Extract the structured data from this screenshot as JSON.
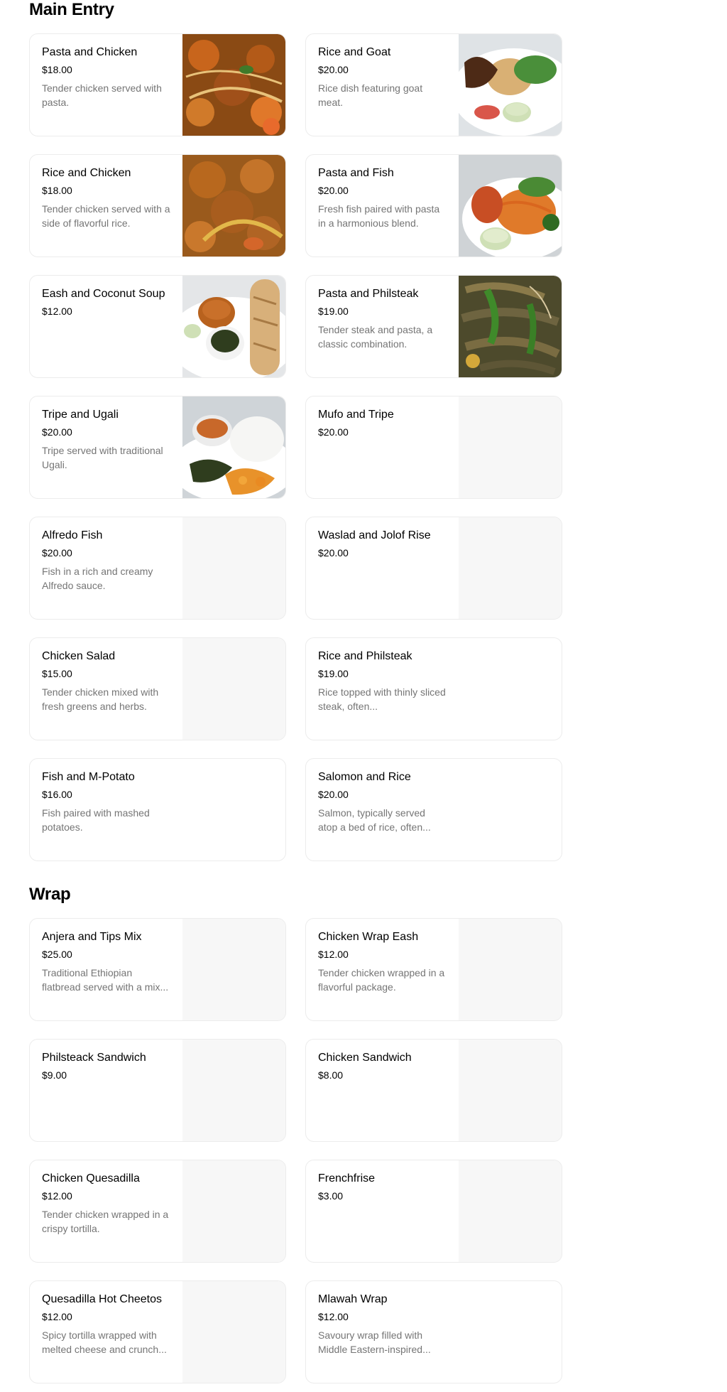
{
  "sections": [
    {
      "title": "Main Entry",
      "items": [
        {
          "name": "Pasta and Chicken",
          "price": "$18.00",
          "description": "Tender chicken served with pasta.",
          "image": "food-photo"
        },
        {
          "name": "Rice and Goat",
          "price": "$20.00",
          "description": "Rice dish featuring goat meat.",
          "image": "food-photo"
        },
        {
          "name": "Rice and Chicken",
          "price": "$18.00",
          "description": "Tender chicken served with a side of flavorful rice.",
          "image": "food-photo"
        },
        {
          "name": "Pasta and Fish",
          "price": "$20.00",
          "description": "Fresh fish paired with pasta in a harmonious blend.",
          "image": "food-photo"
        },
        {
          "name": "Eash and Coconut Soup",
          "price": "$12.00",
          "description": "",
          "image": "food-photo"
        },
        {
          "name": "Pasta and Philsteak",
          "price": "$19.00",
          "description": "Tender steak and pasta, a classic combination.",
          "image": "food-photo"
        },
        {
          "name": "Tripe and Ugali",
          "price": "$20.00",
          "description": "Tripe served with traditional Ugali.",
          "image": "food-photo"
        },
        {
          "name": "Mufo and Tripe",
          "price": "$20.00",
          "description": "",
          "image": "placeholder"
        },
        {
          "name": "Alfredo Fish",
          "price": "$20.00",
          "description": "Fish in a rich and creamy Alfredo sauce.",
          "image": "placeholder"
        },
        {
          "name": "Waslad and Jolof Rise",
          "price": "$20.00",
          "description": "",
          "image": "placeholder"
        },
        {
          "name": "Chicken Salad",
          "price": "$15.00",
          "description": "Tender chicken mixed with fresh greens and herbs.",
          "image": "placeholder"
        },
        {
          "name": "Rice and Philsteak",
          "price": "$19.00",
          "description": "Rice topped with thinly sliced steak, often...",
          "image": "none"
        },
        {
          "name": "Fish and M-Potato",
          "price": "$16.00",
          "description": "Fish paired with mashed potatoes.",
          "image": "none"
        },
        {
          "name": "Salomon and Rice",
          "price": "$20.00",
          "description": "Salmon, typically served atop a bed of rice, often...",
          "image": "none"
        }
      ]
    },
    {
      "title": "Wrap",
      "items": [
        {
          "name": "Anjera and Tips Mix",
          "price": "$25.00",
          "description": "Traditional Ethiopian flatbread served with a mix...",
          "image": "placeholder"
        },
        {
          "name": "Chicken Wrap Eash",
          "price": "$12.00",
          "description": "Tender chicken wrapped in a flavorful package.",
          "image": "placeholder"
        },
        {
          "name": "Philsteack Sandwich",
          "price": "$9.00",
          "description": "",
          "image": "placeholder"
        },
        {
          "name": "Chicken Sandwich",
          "price": "$8.00",
          "description": "",
          "image": "placeholder"
        },
        {
          "name": "Chicken Quesadilla",
          "price": "$12.00",
          "description": "Tender chicken wrapped in a crispy tortilla.",
          "image": "placeholder"
        },
        {
          "name": "Frenchfrise",
          "price": "$3.00",
          "description": "",
          "image": "placeholder"
        },
        {
          "name": "Quesadilla Hot Cheetos",
          "price": "$12.00",
          "description": "Spicy tortilla wrapped with melted cheese and crunch...",
          "image": "placeholder"
        },
        {
          "name": "Mlawah Wrap",
          "price": "$12.00",
          "description": "Savoury wrap filled with Middle Eastern-inspired...",
          "image": "none"
        }
      ]
    }
  ]
}
